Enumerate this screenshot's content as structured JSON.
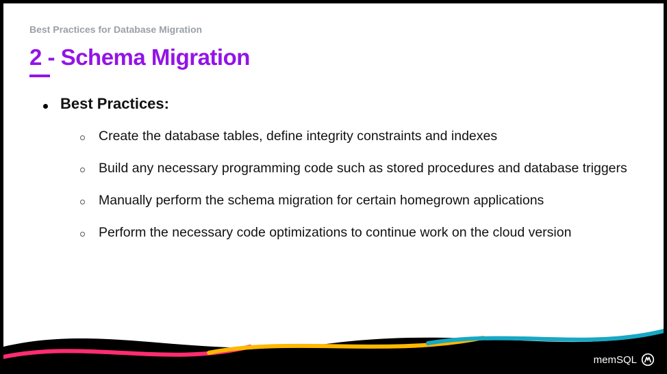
{
  "breadcrumb": "Best Practices for Database Migration",
  "title": "2 - Schema Migration",
  "section_heading": "Best Practices:",
  "bullets": [
    "Create the database tables, define integrity constraints and indexes",
    "Build any necessary programming code such as stored procedures and database triggers",
    "Manually perform the schema migration for certain homegrown applications",
    "Perform the necessary code optimizations to continue work on the cloud version"
  ],
  "footer_brand": "memSQL",
  "colors": {
    "accent": "#9314e7",
    "breadcrumb": "#9aa0a7"
  }
}
